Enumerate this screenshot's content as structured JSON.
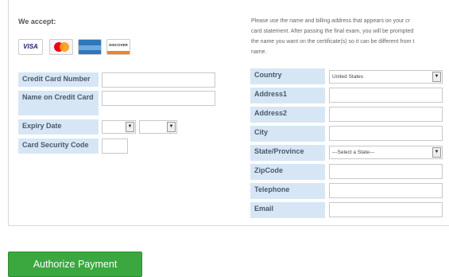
{
  "payment": {
    "accept_title": "We accept:",
    "cards": [
      "visa-card-icon",
      "mastercard-icon",
      "amex-card-icon",
      "discover-card-icon"
    ],
    "card_text": {
      "visa": "VISA",
      "discover": "DISCOVER"
    },
    "labels": {
      "card_number": "Credit Card Number",
      "name_on_card": "Name on Credit Card",
      "expiry": "Expiry Date",
      "security_code": "Card Security Code"
    }
  },
  "billing": {
    "notice_lines": [
      "Please use the name and billing address that appears on your cr",
      "card statement. After passing the final exam, you will be prompted",
      "the name you want on the certificate(s) so it can be different from t",
      "name."
    ],
    "labels": {
      "country": "Country",
      "address1": "Address1",
      "address2": "Address2",
      "city": "City",
      "state": "State/Province",
      "zip": "ZipCode",
      "telephone": "Telephone",
      "email": "Email"
    },
    "country_value": "United States",
    "state_value": "---Select a State---"
  },
  "actions": {
    "authorize": "Authorize Payment"
  },
  "colors": {
    "label_bg": "#d6e6f5",
    "button_bg": "#3aa83f"
  }
}
